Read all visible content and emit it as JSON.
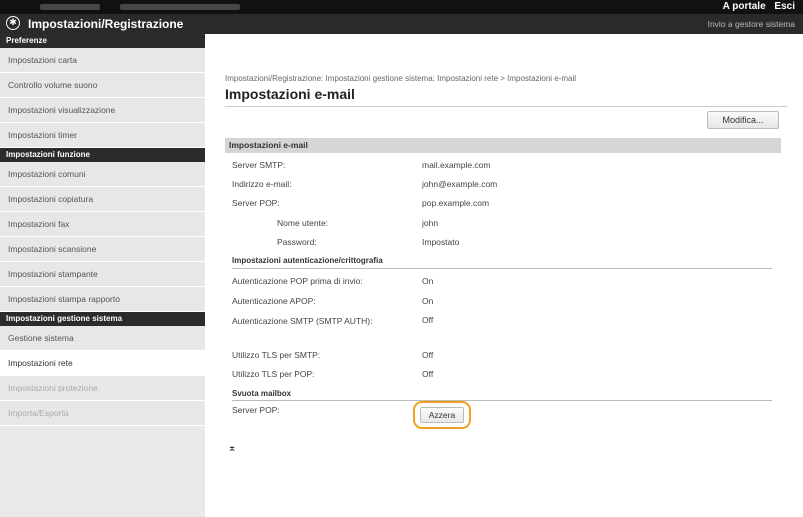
{
  "topbar": {
    "portal": "A portale",
    "logout": "Esci"
  },
  "titlebar": {
    "title": "Impostazioni/Registrazione",
    "right_link": "Invio a gestore sistema",
    "icon": "gear-icon"
  },
  "sidebar": {
    "sections": [
      {
        "heading": "Preferenze",
        "items": [
          "Impostazioni carta",
          "Controllo volume suono",
          "Impostazioni visualizzazione",
          "Impostazioni timer"
        ]
      },
      {
        "heading": "Impostazioni funzione",
        "items": [
          "Impostazioni comuni",
          "Impostazioni copiatura",
          "Impostazioni fax",
          "Impostazioni scansione",
          "Impostazioni stampante",
          "Impostazioni stampa rapporto"
        ]
      },
      {
        "heading": "Impostazioni gestione sistema",
        "items": [
          "Gestione sistema",
          "Impostazioni rete",
          "Impostazioni protezione",
          "Importa/Esporta"
        ]
      }
    ],
    "active": "Impostazioni rete"
  },
  "main": {
    "breadcrumb": "Impostazioni/Registrazione: Impostazioni gestione sistema: Impostazioni rete > Impostazioni e-mail",
    "title": "Impostazioni e-mail",
    "modify_label": "Modifica...",
    "section_title": "Impostazioni e-mail",
    "rows": [
      {
        "label": "Server SMTP:",
        "value": "mail.example.com"
      },
      {
        "label": "Indirizzo e-mail:",
        "value": "john@example.com"
      },
      {
        "label": "Server POP:",
        "value": "pop.example.com"
      },
      {
        "label": "Nome utente:",
        "value": "john"
      },
      {
        "label": "Password:",
        "value": "Impostato"
      }
    ],
    "auth_heading": "Impostazioni autenticazione/crittografia",
    "auth_rows": [
      {
        "label": "Autenticazione POP prima di invio:",
        "value": "On"
      },
      {
        "label": "Autenticazione APOP:",
        "value": "On"
      },
      {
        "label": "Autenticazione SMTP (SMTP AUTH):",
        "value": "Off"
      },
      {
        "label": "Utilizzo TLS per SMTP:",
        "value": "Off"
      },
      {
        "label": "Utilizzo TLS per POP:",
        "value": "Off"
      }
    ],
    "mailbox_heading": "Svuota mailbox",
    "mailbox_label": "Server POP:",
    "reset_label": "Azzera",
    "top_arrow": "⌅"
  }
}
